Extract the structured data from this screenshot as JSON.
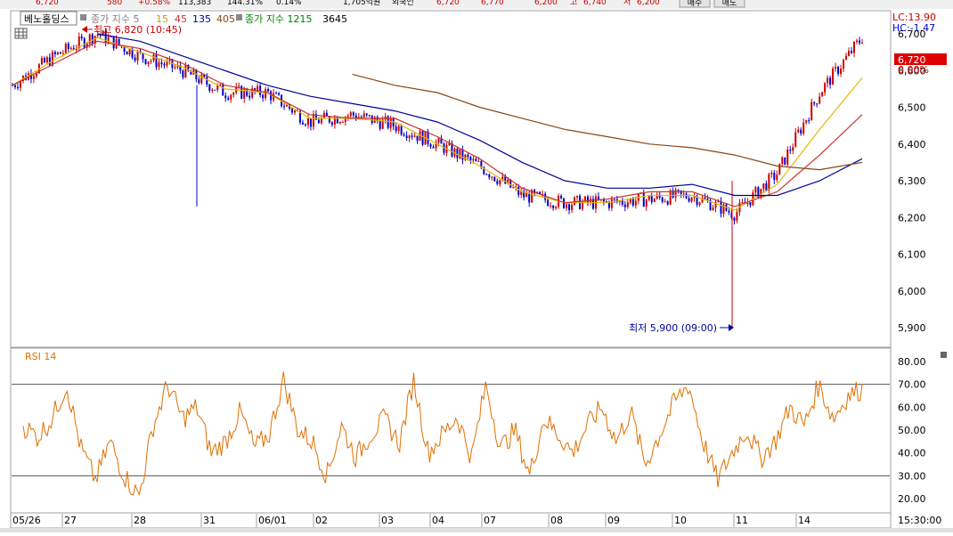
{
  "top_strip": {
    "texts": [
      "6,720",
      "580",
      "+0.58%",
      "113,383",
      "144.31%",
      "0.14%",
      "1,705억원",
      "외국인",
      "6,720",
      "6,770",
      "6,200",
      "고",
      "6,740",
      "저",
      "6,200"
    ],
    "buttons": [
      "매수",
      "매도"
    ]
  },
  "colors": {
    "price_up": "#cc0000",
    "price_down": "#0000cc",
    "ma5": "#e6b800",
    "ma15": "#cc3333",
    "ma45": "#000099",
    "ma135": "#8b4513",
    "rsi": "#e07000"
  },
  "legend": {
    "stock_name": "베노홀딩스",
    "ma_label": "종가 지수 5",
    "periods": [
      "15",
      "45",
      "135",
      "405"
    ],
    "volume_label": "종가 지수 1215",
    "volume_period": "3645"
  },
  "axis_tags": {
    "lc": "LC:13.90",
    "hc": "HC:-1.47",
    "price_tag": "6,720",
    "pct_tag": "0.00%"
  },
  "annotations": {
    "high": "최고 6,820 (10:45)",
    "low": "최저 5,900 (09:00)"
  },
  "rsi_label": "RSI 14",
  "time_label": "15:30:00",
  "chart_data": [
    {
      "type": "line",
      "title": "베노홀딩스",
      "x_labels": [
        "05/26",
        "27",
        "28",
        "31",
        "06/01",
        "02",
        "03",
        "04",
        "07",
        "08",
        "09",
        "10",
        "11",
        "14"
      ],
      "y_ticks": [
        "6,700",
        "6,600",
        "6,500",
        "6,400",
        "6,300",
        "6,200",
        "6,100",
        "6,000",
        "5,900"
      ],
      "ylim": [
        5880,
        6830
      ],
      "series": [
        {
          "name": "종가",
          "values": [
            6560,
            6640,
            6700,
            6640,
            6600,
            6540,
            6540,
            6460,
            6480,
            6450,
            6400,
            6340,
            6260,
            6240,
            6240,
            6250,
            6260,
            6210,
            6320,
            6540,
            6690
          ]
        },
        {
          "name": "5",
          "values": [
            6560,
            6630,
            6690,
            6650,
            6610,
            6550,
            6540,
            6470,
            6470,
            6460,
            6400,
            6340,
            6270,
            6240,
            6240,
            6260,
            6260,
            6220,
            6290,
            6440,
            6580
          ]
        },
        {
          "name": "15",
          "values": [
            6560,
            6620,
            6680,
            6660,
            6620,
            6560,
            6540,
            6480,
            6470,
            6470,
            6420,
            6360,
            6280,
            6240,
            6250,
            6270,
            6270,
            6230,
            6270,
            6370,
            6480
          ]
        },
        {
          "name": "45",
          "values": [
            null,
            null,
            6700,
            6680,
            6640,
            6600,
            6560,
            6530,
            6510,
            6490,
            6460,
            6410,
            6350,
            6300,
            6280,
            6280,
            6290,
            6260,
            6260,
            6300,
            6360
          ]
        },
        {
          "name": "135",
          "values": [
            null,
            null,
            null,
            null,
            null,
            null,
            null,
            null,
            6590,
            6560,
            6540,
            6500,
            6470,
            6440,
            6420,
            6400,
            6390,
            6370,
            6340,
            6330,
            6350
          ]
        }
      ],
      "annotations": [
        "최고 6,820 (10:45)",
        "최저 5,900 (09:00)"
      ]
    },
    {
      "type": "line",
      "title": "RSI 14",
      "y_ticks": [
        "80.00",
        "70.00",
        "60.00",
        "50.00",
        "40.00",
        "30.00",
        "20.00"
      ],
      "ylim": [
        15,
        84
      ],
      "reference_lines": [
        70,
        30
      ],
      "series": [
        {
          "name": "RSI 14",
          "values": [
            52,
            47,
            55,
            70,
            42,
            28,
            45,
            30,
            21,
            52,
            70,
            55,
            60,
            40,
            45,
            58,
            42,
            48,
            72,
            50,
            45,
            30,
            52,
            38,
            48,
            55,
            44,
            72,
            40,
            48,
            56,
            38,
            70,
            42,
            50,
            30,
            55,
            48,
            40,
            52,
            60,
            45,
            58,
            35,
            48,
            62,
            70,
            45,
            28,
            40,
            50,
            38,
            45,
            60,
            52,
            70,
            55,
            65,
            68
          ]
        }
      ]
    }
  ]
}
